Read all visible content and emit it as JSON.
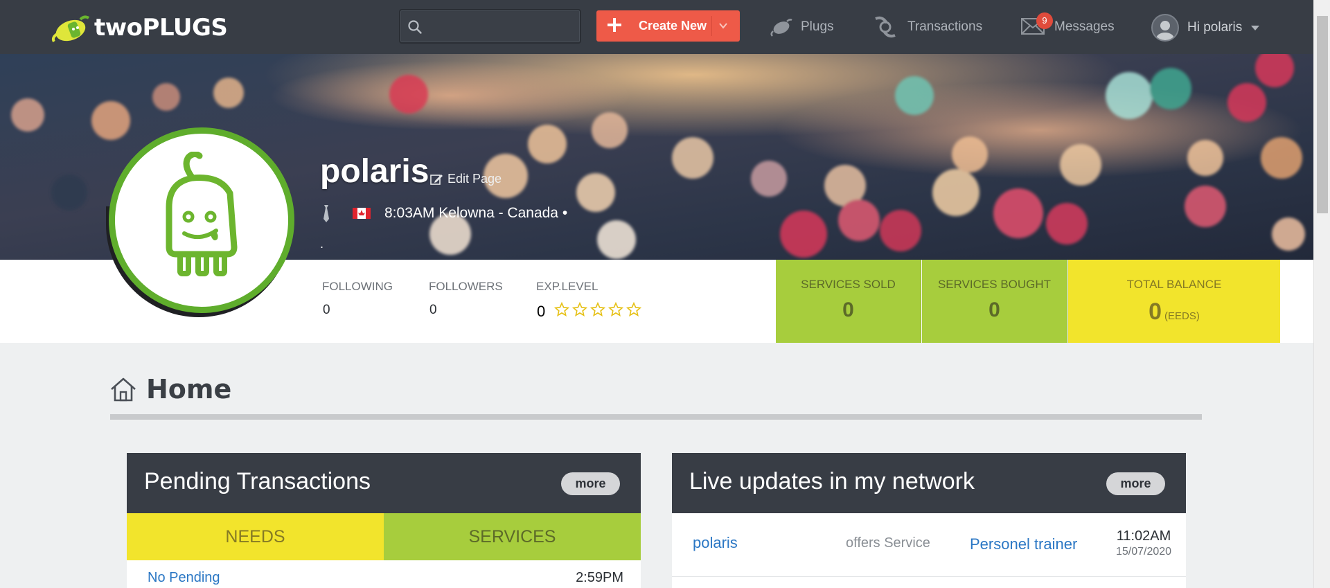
{
  "nav": {
    "logo_text": "twoPLUGS",
    "search_placeholder": "",
    "create_label": "Create New",
    "plugs_label": "Plugs",
    "transactions_label": "Transactions",
    "messages_label": "Messages",
    "messages_count": "9",
    "user_label": "Hi polaris"
  },
  "profile": {
    "username": "polaris",
    "edit_label": "Edit Page",
    "location": "8:03AM Kelowna - Canada •",
    "extra": "."
  },
  "stats": {
    "following_label": "FOLLOWING",
    "following_value": "0",
    "followers_label": "FOLLOWERS",
    "followers_value": "0",
    "exp_label": "EXP.LEVEL",
    "exp_value": "0",
    "exp_stars": 0,
    "sold_label": "SERVICES SOLD",
    "sold_value": "0",
    "bought_label": "SERVICES BOUGHT",
    "bought_value": "0",
    "balance_label": "TOTAL BALANCE",
    "balance_value": "0",
    "balance_unit": "(EEDS)"
  },
  "home": {
    "title": "Home"
  },
  "pending": {
    "title": "Pending Transactions",
    "more_label": "more",
    "tab_needs": "NEEDS",
    "tab_services": "SERVICES",
    "row_label": "No Pending",
    "row_time": "2:59PM"
  },
  "updates": {
    "title": "Live updates in my network",
    "more_label": "more",
    "items": [
      {
        "user": "polaris",
        "action": "offers Service",
        "service": "Personel trainer",
        "time": "11:02AM",
        "date": "15/07/2020"
      }
    ]
  },
  "colors": {
    "nav_bg": "#383d45",
    "create_btn": "#ee5a48",
    "green": "#a7cd3d",
    "yellow": "#f2e42c",
    "profile_ring": "#5fad2c",
    "link": "#2b77c4"
  }
}
